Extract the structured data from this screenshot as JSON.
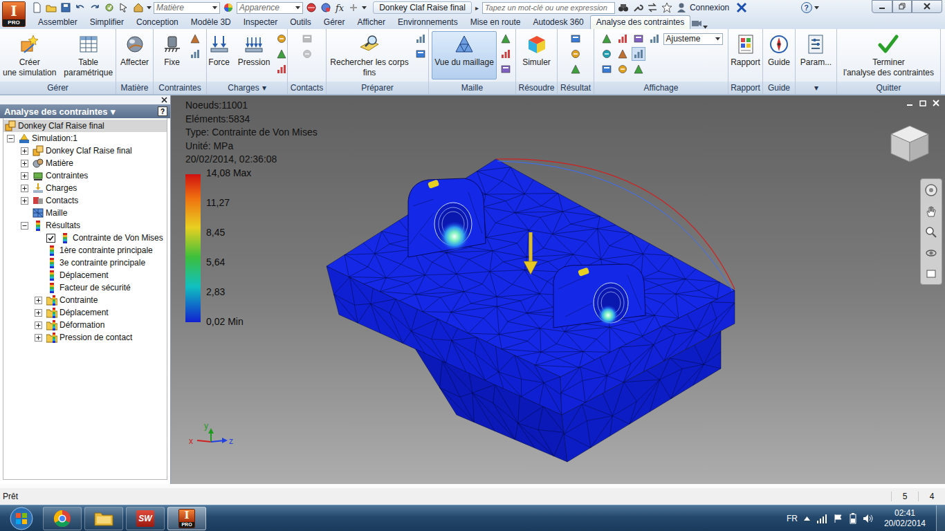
{
  "app_logo": {
    "letter": "I",
    "badge": "PRO"
  },
  "quick_access": {
    "material": "Matière",
    "appearance": "Apparence",
    "formula": "fx"
  },
  "window": {
    "title": "Donkey Claf Raise final",
    "title_arrow": "▸"
  },
  "search": {
    "placeholder": "Tapez un mot-clé ou une expression"
  },
  "account": {
    "label": "Connexion"
  },
  "help": {
    "glyph": "?"
  },
  "menu_tabs": [
    {
      "label": "Assembler",
      "selected": false
    },
    {
      "label": "Simplifier",
      "selected": false
    },
    {
      "label": "Conception",
      "selected": false
    },
    {
      "label": "Modèle 3D",
      "selected": false
    },
    {
      "label": "Inspecter",
      "selected": false
    },
    {
      "label": "Outils",
      "selected": false
    },
    {
      "label": "Gérer",
      "selected": false
    },
    {
      "label": "Afficher",
      "selected": false
    },
    {
      "label": "Environnements",
      "selected": false
    },
    {
      "label": "Mise en route",
      "selected": false
    },
    {
      "label": "Autodesk 360",
      "selected": false
    },
    {
      "label": "Analyse des contraintes",
      "selected": true
    }
  ],
  "ribbon": {
    "groups": [
      {
        "label": "Gérer",
        "buttons": [
          {
            "lines": [
              "Créer",
              "une simulation"
            ],
            "selected": false
          },
          {
            "lines": [
              "Table",
              "paramétrique"
            ],
            "selected": false
          }
        ]
      },
      {
        "label": "Matière",
        "buttons": [
          {
            "lines": [
              "Affecter"
            ],
            "selected": false
          }
        ]
      },
      {
        "label": "Contraintes",
        "buttons": [
          {
            "lines": [
              "Fixe"
            ],
            "selected": false
          }
        ]
      },
      {
        "label": "Charges",
        "arrow": "▾",
        "buttons": [
          {
            "lines": [
              "Force"
            ],
            "selected": false
          },
          {
            "lines": [
              "Pression"
            ],
            "selected": false
          }
        ]
      },
      {
        "label": "Contacts",
        "buttons": []
      },
      {
        "label": "Préparer",
        "buttons": [
          {
            "lines": [
              "Rechercher les corps",
              "fins"
            ],
            "selected": false
          }
        ]
      },
      {
        "label": "Maille",
        "buttons": [
          {
            "lines": [
              "Vue du maillage"
            ],
            "selected": true
          }
        ]
      },
      {
        "label": "Résoudre",
        "buttons": [
          {
            "lines": [
              "Simuler"
            ],
            "selected": false
          }
        ]
      },
      {
        "label": "Résultat",
        "buttons": []
      },
      {
        "label": "Affichage",
        "dropdown": "Ajusteme",
        "buttons": []
      },
      {
        "label": "Rapport",
        "buttons": [
          {
            "lines": [
              "Rapport"
            ],
            "selected": false
          }
        ]
      },
      {
        "label": "Guide",
        "buttons": [
          {
            "lines": [
              "Guide"
            ],
            "selected": false
          }
        ]
      },
      {
        "label": "▾",
        "buttons": [
          {
            "lines": [
              "Param..."
            ],
            "selected": false
          }
        ]
      },
      {
        "label": "Quitter",
        "buttons": [
          {
            "lines": [
              "Terminer",
              "l'analyse des contraintes"
            ],
            "selected": false
          }
        ]
      }
    ]
  },
  "browser": {
    "title": "Analyse des contraintes",
    "title_arrow": "▾",
    "help": "?",
    "items": [
      {
        "label": "Donkey Claf Raise final",
        "level": 0,
        "kind": "model",
        "selected": true
      },
      {
        "label": "Simulation:1",
        "level": 0,
        "kind": "simulation",
        "expanded": true,
        "selected": false
      },
      {
        "label": "Donkey Claf Raise final",
        "level": 1,
        "kind": "model",
        "expanded": false,
        "selected": false
      },
      {
        "label": "Matière",
        "level": 1,
        "kind": "material",
        "expanded": false,
        "selected": false
      },
      {
        "label": "Contraintes",
        "level": 1,
        "kind": "constraint",
        "expanded": false,
        "selected": false
      },
      {
        "label": "Charges",
        "level": 1,
        "kind": "load",
        "expanded": false,
        "selected": false
      },
      {
        "label": "Contacts",
        "level": 1,
        "kind": "contact",
        "expanded": false,
        "selected": false
      },
      {
        "label": "Maille",
        "level": 1,
        "kind": "mesh",
        "selected": false
      },
      {
        "label": "Résultats",
        "level": 1,
        "kind": "results",
        "expanded": true,
        "selected": false
      },
      {
        "label": "Contrainte de Von Mises",
        "level": 2,
        "kind": "result",
        "checked": true,
        "selected": false
      },
      {
        "label": "1ère contrainte principale",
        "level": 2,
        "kind": "result",
        "checked": false,
        "selected": false
      },
      {
        "label": "3e contrainte principale",
        "level": 2,
        "kind": "result",
        "checked": false,
        "selected": false
      },
      {
        "label": "Déplacement",
        "level": 2,
        "kind": "result",
        "checked": false,
        "selected": false
      },
      {
        "label": "Facteur de sécurité",
        "level": 2,
        "kind": "result",
        "checked": false,
        "selected": false
      },
      {
        "label": "Contrainte",
        "level": 2,
        "kind": "folder",
        "expanded": false,
        "selected": false
      },
      {
        "label": "Déplacement",
        "level": 2,
        "kind": "folder",
        "expanded": false,
        "selected": false
      },
      {
        "label": "Déformation",
        "level": 2,
        "kind": "folder",
        "expanded": false,
        "selected": false
      },
      {
        "label": "Pression de contact",
        "level": 2,
        "kind": "folder",
        "expanded": false,
        "selected": false
      }
    ]
  },
  "viewport": {
    "info": [
      "Noeuds:11001",
      "Eléments:5834",
      "Type: Contrainte de Von Mises",
      "Unité: MPa",
      "20/02/2014, 02:36:08"
    ],
    "legend": [
      "14,08 Max",
      "11,27",
      "8,45",
      "5,64",
      "2,83",
      "0,02 Min"
    ],
    "axes": [
      {
        "label": "x",
        "color": "#d02020"
      },
      {
        "label": "y",
        "color": "#1f9a1f"
      },
      {
        "label": "z",
        "color": "#2040e0"
      }
    ]
  },
  "status_bar": {
    "text": "Prêt",
    "fields": [
      "5",
      "4"
    ]
  },
  "taskbar": {
    "apps": [
      {
        "kind": "chrome",
        "active": false
      },
      {
        "kind": "explorer",
        "active": false
      },
      {
        "kind": "solidworks",
        "label": "SW",
        "active": false
      },
      {
        "kind": "inventor",
        "label": "I",
        "badge": "PRO",
        "active": true
      }
    ],
    "language": "FR",
    "time": "02:41",
    "date": "20/02/2014"
  }
}
